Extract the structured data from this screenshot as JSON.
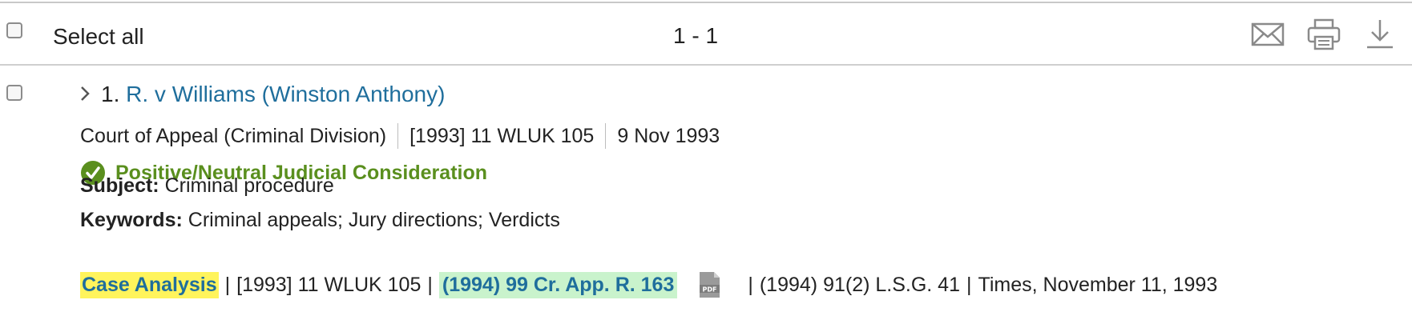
{
  "toolbar": {
    "select_all_label": "Select all",
    "range": "1 - 1",
    "icons": [
      "email-icon",
      "print-icon",
      "download-icon"
    ]
  },
  "result": {
    "number": "1.",
    "title": "R. v Williams (Winston Anthony)",
    "court": "Court of Appeal (Criminal Division)",
    "citation": "[1993] 11 WLUK 105",
    "date": "9 Nov 1993",
    "status": "Positive/Neutral Judicial Consideration",
    "subject_label": "Subject:",
    "subject": "Criminal procedure",
    "keywords_label": "Keywords:",
    "keywords": "Criminal appeals; Jury directions; Verdicts",
    "case_analysis": "Case Analysis",
    "cite_wluk": "[1993] 11 WLUK 105",
    "cite_cr_app": "(1994) 99 Cr. App. R. 163",
    "cite_lsg": "(1994) 91(2) L.S.G. 41",
    "cite_times": "Times, November 11, 1993",
    "pipe": "|"
  },
  "colors": {
    "link": "#1f6e9c",
    "status_green": "#5a8f1e",
    "highlight_yellow": "#fff45c",
    "highlight_green": "#c9f3cc"
  }
}
